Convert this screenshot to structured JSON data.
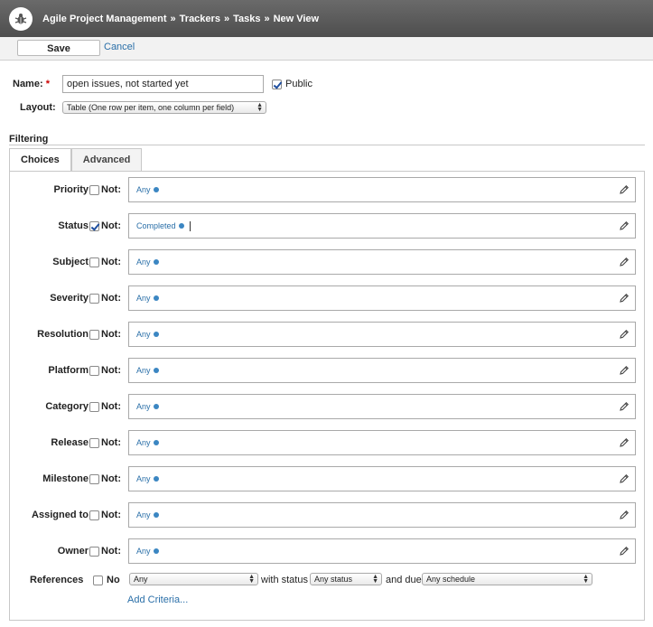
{
  "header": {
    "crumbs": [
      "Agile Project Management",
      "Trackers",
      "Tasks",
      "New View"
    ],
    "separator": "»"
  },
  "toolbar": {
    "save_label": "Save",
    "cancel_label": "Cancel"
  },
  "form": {
    "name_label": "Name:",
    "name_required": "*",
    "name_value": "open issues, not started yet",
    "public_label": "Public",
    "public_checked": true,
    "layout_label": "Layout:",
    "layout_value": "Table (One row per item, one column per field)"
  },
  "filtering": {
    "title": "Filtering",
    "tabs": [
      "Choices",
      "Advanced"
    ],
    "active_tab": "Choices",
    "not_label": "Not:",
    "rows": [
      {
        "label": "Priority",
        "not_checked": false,
        "value": "Any"
      },
      {
        "label": "Status",
        "not_checked": true,
        "value": "Completed"
      },
      {
        "label": "Subject",
        "not_checked": false,
        "value": "Any"
      },
      {
        "label": "Severity",
        "not_checked": false,
        "value": "Any"
      },
      {
        "label": "Resolution",
        "not_checked": false,
        "value": "Any"
      },
      {
        "label": "Platform",
        "not_checked": false,
        "value": "Any"
      },
      {
        "label": "Category",
        "not_checked": false,
        "value": "Any"
      },
      {
        "label": "Release",
        "not_checked": false,
        "value": "Any"
      },
      {
        "label": "Milestone",
        "not_checked": false,
        "value": "Any"
      },
      {
        "label": "Assigned to",
        "not_checked": false,
        "value": "Any"
      },
      {
        "label": "Owner",
        "not_checked": false,
        "value": "Any"
      }
    ],
    "references": {
      "label": "References",
      "no_label": "No",
      "select_value": "Any",
      "with_status_text": "with status",
      "status_value": "Any status",
      "and_due_text": "and due",
      "due_value": "Any schedule"
    },
    "add_criteria_label": "Add Criteria..."
  },
  "colors": {
    "header_bg": "#555555",
    "link": "#2a6fa8",
    "tag_icon": "#3b86c2"
  }
}
